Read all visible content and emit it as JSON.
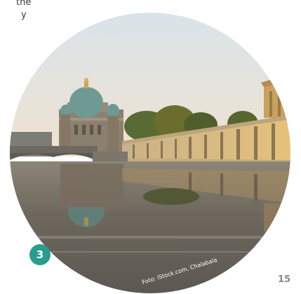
{
  "page": {
    "fragment_lines": [
      "the",
      "y"
    ],
    "badge_number": "3",
    "page_number": "15",
    "photo_credit": "Foto: iStock.com, Chalabala"
  },
  "colors": {
    "badge": "#2a9d8f",
    "page_number": "#8a8a8a"
  }
}
